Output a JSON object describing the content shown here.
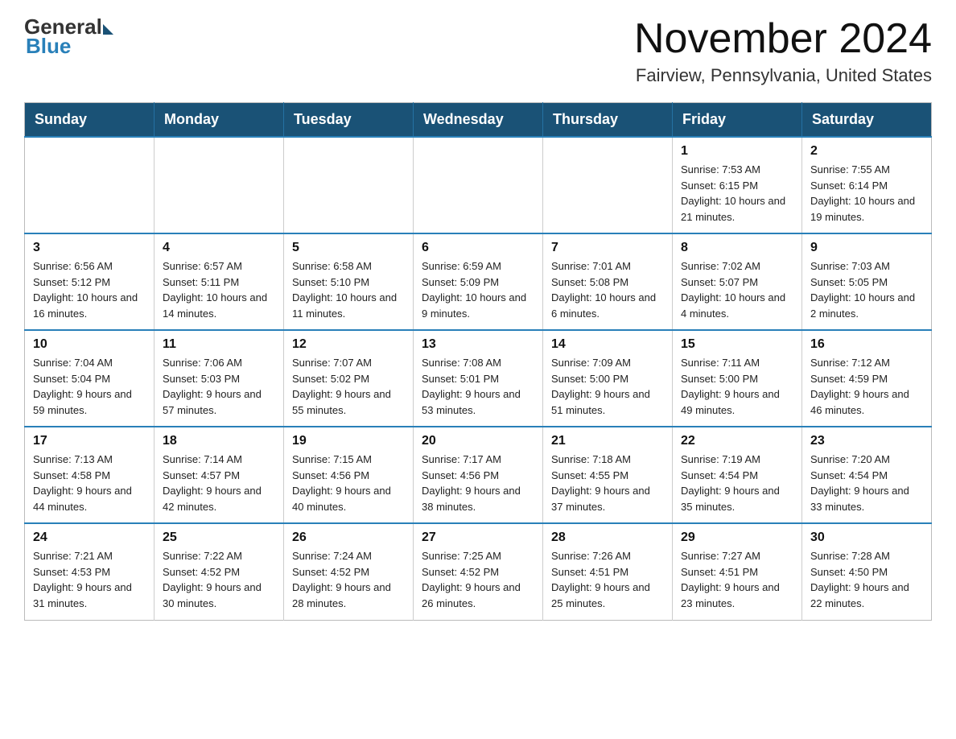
{
  "header": {
    "logo_general": "General",
    "logo_blue": "Blue",
    "month_title": "November 2024",
    "location": "Fairview, Pennsylvania, United States"
  },
  "calendar": {
    "days_of_week": [
      "Sunday",
      "Monday",
      "Tuesday",
      "Wednesday",
      "Thursday",
      "Friday",
      "Saturday"
    ],
    "weeks": [
      [
        {
          "day": "",
          "info": ""
        },
        {
          "day": "",
          "info": ""
        },
        {
          "day": "",
          "info": ""
        },
        {
          "day": "",
          "info": ""
        },
        {
          "day": "",
          "info": ""
        },
        {
          "day": "1",
          "info": "Sunrise: 7:53 AM\nSunset: 6:15 PM\nDaylight: 10 hours and 21 minutes."
        },
        {
          "day": "2",
          "info": "Sunrise: 7:55 AM\nSunset: 6:14 PM\nDaylight: 10 hours and 19 minutes."
        }
      ],
      [
        {
          "day": "3",
          "info": "Sunrise: 6:56 AM\nSunset: 5:12 PM\nDaylight: 10 hours and 16 minutes."
        },
        {
          "day": "4",
          "info": "Sunrise: 6:57 AM\nSunset: 5:11 PM\nDaylight: 10 hours and 14 minutes."
        },
        {
          "day": "5",
          "info": "Sunrise: 6:58 AM\nSunset: 5:10 PM\nDaylight: 10 hours and 11 minutes."
        },
        {
          "day": "6",
          "info": "Sunrise: 6:59 AM\nSunset: 5:09 PM\nDaylight: 10 hours and 9 minutes."
        },
        {
          "day": "7",
          "info": "Sunrise: 7:01 AM\nSunset: 5:08 PM\nDaylight: 10 hours and 6 minutes."
        },
        {
          "day": "8",
          "info": "Sunrise: 7:02 AM\nSunset: 5:07 PM\nDaylight: 10 hours and 4 minutes."
        },
        {
          "day": "9",
          "info": "Sunrise: 7:03 AM\nSunset: 5:05 PM\nDaylight: 10 hours and 2 minutes."
        }
      ],
      [
        {
          "day": "10",
          "info": "Sunrise: 7:04 AM\nSunset: 5:04 PM\nDaylight: 9 hours and 59 minutes."
        },
        {
          "day": "11",
          "info": "Sunrise: 7:06 AM\nSunset: 5:03 PM\nDaylight: 9 hours and 57 minutes."
        },
        {
          "day": "12",
          "info": "Sunrise: 7:07 AM\nSunset: 5:02 PM\nDaylight: 9 hours and 55 minutes."
        },
        {
          "day": "13",
          "info": "Sunrise: 7:08 AM\nSunset: 5:01 PM\nDaylight: 9 hours and 53 minutes."
        },
        {
          "day": "14",
          "info": "Sunrise: 7:09 AM\nSunset: 5:00 PM\nDaylight: 9 hours and 51 minutes."
        },
        {
          "day": "15",
          "info": "Sunrise: 7:11 AM\nSunset: 5:00 PM\nDaylight: 9 hours and 49 minutes."
        },
        {
          "day": "16",
          "info": "Sunrise: 7:12 AM\nSunset: 4:59 PM\nDaylight: 9 hours and 46 minutes."
        }
      ],
      [
        {
          "day": "17",
          "info": "Sunrise: 7:13 AM\nSunset: 4:58 PM\nDaylight: 9 hours and 44 minutes."
        },
        {
          "day": "18",
          "info": "Sunrise: 7:14 AM\nSunset: 4:57 PM\nDaylight: 9 hours and 42 minutes."
        },
        {
          "day": "19",
          "info": "Sunrise: 7:15 AM\nSunset: 4:56 PM\nDaylight: 9 hours and 40 minutes."
        },
        {
          "day": "20",
          "info": "Sunrise: 7:17 AM\nSunset: 4:56 PM\nDaylight: 9 hours and 38 minutes."
        },
        {
          "day": "21",
          "info": "Sunrise: 7:18 AM\nSunset: 4:55 PM\nDaylight: 9 hours and 37 minutes."
        },
        {
          "day": "22",
          "info": "Sunrise: 7:19 AM\nSunset: 4:54 PM\nDaylight: 9 hours and 35 minutes."
        },
        {
          "day": "23",
          "info": "Sunrise: 7:20 AM\nSunset: 4:54 PM\nDaylight: 9 hours and 33 minutes."
        }
      ],
      [
        {
          "day": "24",
          "info": "Sunrise: 7:21 AM\nSunset: 4:53 PM\nDaylight: 9 hours and 31 minutes."
        },
        {
          "day": "25",
          "info": "Sunrise: 7:22 AM\nSunset: 4:52 PM\nDaylight: 9 hours and 30 minutes."
        },
        {
          "day": "26",
          "info": "Sunrise: 7:24 AM\nSunset: 4:52 PM\nDaylight: 9 hours and 28 minutes."
        },
        {
          "day": "27",
          "info": "Sunrise: 7:25 AM\nSunset: 4:52 PM\nDaylight: 9 hours and 26 minutes."
        },
        {
          "day": "28",
          "info": "Sunrise: 7:26 AM\nSunset: 4:51 PM\nDaylight: 9 hours and 25 minutes."
        },
        {
          "day": "29",
          "info": "Sunrise: 7:27 AM\nSunset: 4:51 PM\nDaylight: 9 hours and 23 minutes."
        },
        {
          "day": "30",
          "info": "Sunrise: 7:28 AM\nSunset: 4:50 PM\nDaylight: 9 hours and 22 minutes."
        }
      ]
    ]
  }
}
